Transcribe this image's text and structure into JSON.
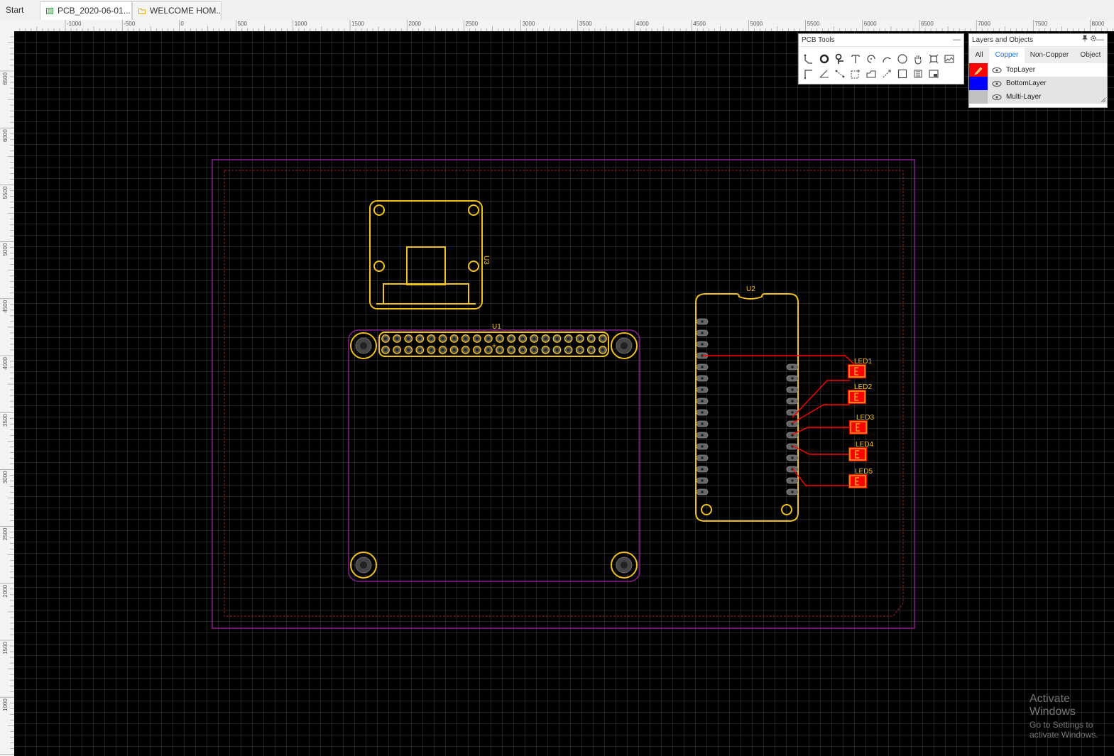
{
  "tabs": {
    "start": "Start",
    "pcb": "PCB_2020-06-01...",
    "welcome": "WELCOME HOM..."
  },
  "ruler": {
    "horizontal": [
      "-1000",
      "-500",
      "0",
      "500",
      "1000",
      "1500",
      "2000",
      "2500",
      "3000",
      "3500",
      "4000",
      "4500",
      "5000",
      "5500",
      "6000",
      "6500",
      "7000",
      "7500",
      "8000"
    ],
    "vertical": [
      "6500",
      "6000",
      "5500",
      "5000",
      "4500",
      "4000",
      "3500",
      "3000",
      "2500",
      "2000",
      "1500",
      "1000"
    ]
  },
  "pcb_tools": {
    "title": "PCB Tools",
    "minimize": "—",
    "tools": [
      "track",
      "pad",
      "via",
      "text",
      "arc-center",
      "arc",
      "circle",
      "pan",
      "canvas-origin",
      "image",
      "line",
      "angle",
      "connect-pad",
      "area",
      "solid-region",
      "measure",
      "rectangle",
      "copper-area",
      "dimension"
    ]
  },
  "layers_panel": {
    "title": "Layers and Objects",
    "tabs": [
      "All",
      "Copper",
      "Non-Copper",
      "Object"
    ],
    "active_tab": "Copper",
    "layers": [
      {
        "name": "TopLayer",
        "color": "#ff0000"
      },
      {
        "name": "BottomLayer",
        "color": "#0000ff"
      },
      {
        "name": "Multi-Layer",
        "color": "#c0c0c0"
      }
    ]
  },
  "designators": {
    "u1": "U1",
    "u2": "U2",
    "u3": "U3",
    "led1": "LED1",
    "led2": "LED2",
    "led3": "LED3",
    "led4": "LED4",
    "led5": "LED5"
  },
  "colors": {
    "board_outline": "#8b1f8f",
    "silkscreen": "#f2c21b",
    "top_copper": "#ff0000",
    "keepout": "#c0392b"
  },
  "watermark": {
    "line1": "Activate Windows",
    "line2": "Go to Settings to activate Windows."
  }
}
